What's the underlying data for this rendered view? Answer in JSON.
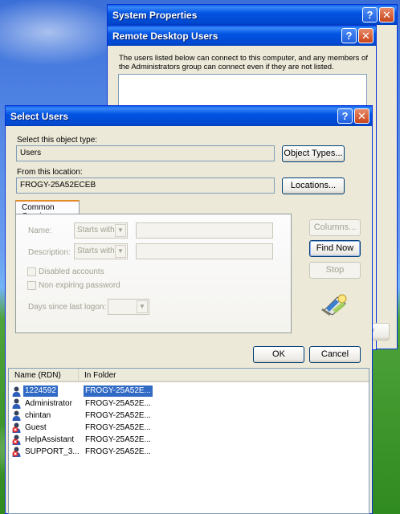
{
  "system_properties": {
    "title": "System Properties",
    "help": "?",
    "close": "✕"
  },
  "rdu": {
    "title": "Remote Desktop Users",
    "help": "?",
    "close": "✕",
    "desc": "The users listed below can connect to this computer, and any members of the Administrators group can connect even if they are not listed.",
    "partial_apply": "ply"
  },
  "select_users": {
    "title": "Select Users",
    "help": "?",
    "close": "✕",
    "object_type_label": "Select this object type:",
    "object_type_value": "Users",
    "object_types_button": "Object Types...",
    "location_label": "From this location:",
    "location_value": "FROGY-25A52ECEB",
    "locations_button": "Locations...",
    "tab": "Common Queries",
    "name_label": "Name:",
    "name_combo": "Starts with",
    "description_label": "Description:",
    "description_combo": "Starts with",
    "disabled_accounts": "Disabled accounts",
    "non_expiring": "Non expiring password",
    "days_since_logon": "Days since last logon:",
    "columns_button": "Columns...",
    "find_now_button": "Find Now",
    "stop_button": "Stop",
    "ok_button": "OK",
    "cancel_button": "Cancel"
  },
  "results": {
    "columns": [
      "Name (RDN)",
      "In Folder"
    ],
    "rows": [
      {
        "name": "1224592",
        "folder": "FROGY-25A52E...",
        "icon": "user-icon",
        "selected": true
      },
      {
        "name": "Administrator",
        "folder": "FROGY-25A52E...",
        "icon": "user-icon"
      },
      {
        "name": "chintan",
        "folder": "FROGY-25A52E...",
        "icon": "user-icon"
      },
      {
        "name": "Guest",
        "folder": "FROGY-25A52E...",
        "icon": "disabled-user-icon"
      },
      {
        "name": "HelpAssistant",
        "folder": "FROGY-25A52E...",
        "icon": "disabled-user-icon"
      },
      {
        "name": "SUPPORT_3...",
        "folder": "FROGY-25A52E...",
        "icon": "disabled-user-icon"
      }
    ]
  }
}
